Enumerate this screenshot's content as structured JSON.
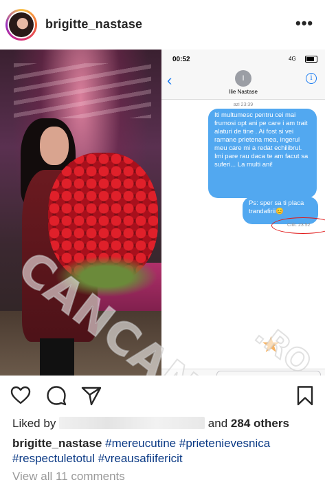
{
  "header": {
    "username": "brigitte_nastase",
    "more_icon": "more-horizontal-icon"
  },
  "phone": {
    "status_time": "00:52",
    "network": "4G",
    "contact_initial": "I",
    "contact_name": "Ilie Nastase",
    "date_label": "azi 23:39",
    "messages": [
      "Iti multumesc pentru cei mai frumosi opt ani pe care i am trait alaturi de tine . Ai fost si vei ramane prietena mea, ingerul meu care mi a redat echilibrul. Imi pare rau daca te am facut sa suferi... La multi ani!",
      "Ps: sper sa ti placa trandafirii😊"
    ],
    "read_receipt": "Citit: 23:52"
  },
  "watermark": {
    "text": "CANCAN",
    "tld": ".RO"
  },
  "actions": {
    "like_icon": "heart-icon",
    "comment_icon": "comment-icon",
    "share_icon": "send-icon",
    "save_icon": "bookmark-icon"
  },
  "likes": {
    "prefix": "Liked by",
    "suffix_and": "and",
    "others": "284 others"
  },
  "caption": {
    "username": "brigitte_nastase",
    "hashtags": [
      "#mereucutine",
      "#prietenievesnica",
      "#respectuletotul",
      "#vreausafiifericit"
    ]
  },
  "comments": {
    "view_all": "View all 11 comments"
  },
  "colors": {
    "imessage_blue": "#52a8f0",
    "hashtag": "#0b3a85",
    "receipt_circle": "#e01818"
  }
}
